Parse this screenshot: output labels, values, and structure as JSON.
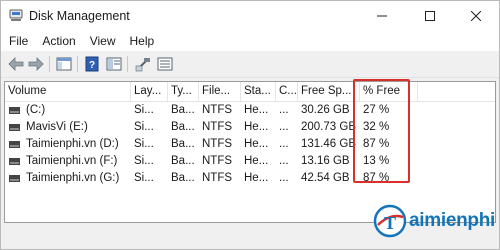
{
  "window": {
    "title": "Disk Management",
    "app_icon": "disk-management-icon",
    "controls": [
      "minimize-icon",
      "maximize-icon",
      "close-icon"
    ]
  },
  "menu": {
    "items": [
      "File",
      "Action",
      "View",
      "Help"
    ]
  },
  "toolbar": {
    "buttons": [
      "back-arrow-icon",
      "forward-arrow-icon",
      "console-tree-icon",
      "help-icon",
      "properties-icon",
      "connect-icon",
      "show-hide-icon"
    ]
  },
  "volume_list": {
    "columns": [
      "Volume",
      "Lay...",
      "Ty...",
      "File...",
      "Sta...",
      "C...",
      "Free Sp...",
      "% Free"
    ],
    "rows": [
      {
        "volume": "(C:)",
        "layout": "Si...",
        "type": "Ba...",
        "fs": "NTFS",
        "status": "He...",
        "capacity": "...",
        "free": "30.26 GB",
        "pct": "27 %"
      },
      {
        "volume": "MavisVi (E:)",
        "layout": "Si...",
        "type": "Ba...",
        "fs": "NTFS",
        "status": "He...",
        "capacity": "...",
        "free": "200.73 GB",
        "pct": "32 %"
      },
      {
        "volume": "Taimienphi.vn (D:)",
        "layout": "Si...",
        "type": "Ba...",
        "fs": "NTFS",
        "status": "He...",
        "capacity": "...",
        "free": "131.46 GB",
        "pct": "87 %"
      },
      {
        "volume": "Taimienphi.vn (F:)",
        "layout": "Si...",
        "type": "Ba...",
        "fs": "NTFS",
        "status": "He...",
        "capacity": "...",
        "free": "13.16 GB",
        "pct": "13 %"
      },
      {
        "volume": "Taimienphi.vn (G:)",
        "layout": "Si...",
        "type": "Ba...",
        "fs": "NTFS",
        "status": "He...",
        "capacity": "...",
        "free": "42.54 GB",
        "pct": "87 %"
      }
    ]
  },
  "annotation": {
    "highlight_color": "#d9302a"
  },
  "watermark": {
    "text": "aimienphi",
    "logo_letter": "T",
    "color": "#1474b8"
  }
}
